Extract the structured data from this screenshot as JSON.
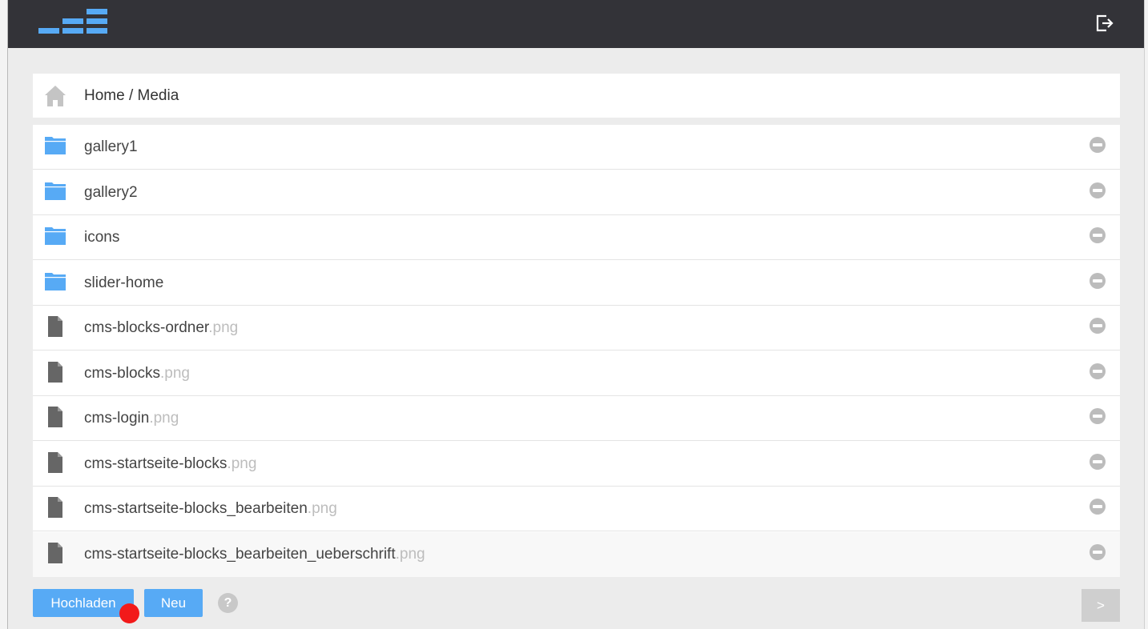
{
  "header": {
    "logo_icon": "bar-chart-logo-icon",
    "logout_icon": "logout-icon"
  },
  "breadcrumb": {
    "icon": "home-icon",
    "text": "Home / Media"
  },
  "files": [
    {
      "type": "folder",
      "name": "gallery1",
      "ext": ""
    },
    {
      "type": "folder",
      "name": "gallery2",
      "ext": ""
    },
    {
      "type": "folder",
      "name": "icons",
      "ext": ""
    },
    {
      "type": "folder",
      "name": "slider-home",
      "ext": ""
    },
    {
      "type": "file",
      "name": "cms-blocks-ordner",
      "ext": ".png"
    },
    {
      "type": "file",
      "name": "cms-blocks",
      "ext": ".png"
    },
    {
      "type": "file",
      "name": "cms-login",
      "ext": ".png"
    },
    {
      "type": "file",
      "name": "cms-startseite-blocks",
      "ext": ".png"
    },
    {
      "type": "file",
      "name": "cms-startseite-blocks_bearbeiten",
      "ext": ".png"
    },
    {
      "type": "file",
      "name": "cms-startseite-blocks_bearbeiten_ueberschrift",
      "ext": ".png"
    }
  ],
  "actions": {
    "upload_label": "Hochladen",
    "new_label": "Neu",
    "help_label": "?",
    "next_label": ">"
  },
  "colors": {
    "accent": "#57aaf5",
    "header_bg": "#333338",
    "folder": "#57aaf5",
    "file": "#666666"
  }
}
